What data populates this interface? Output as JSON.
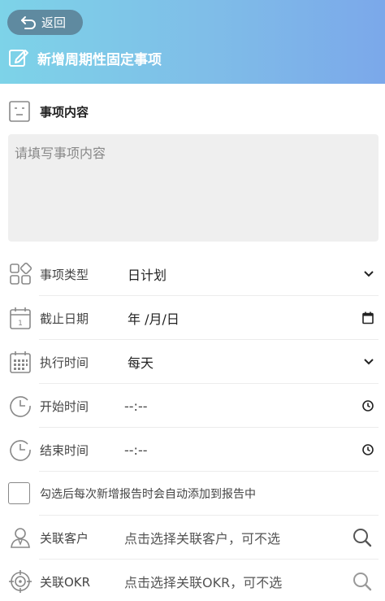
{
  "header": {
    "back_label": "返回",
    "title": "新增周期性固定事项"
  },
  "content_section": {
    "title": "事项内容",
    "placeholder": "请填写事项内容"
  },
  "fields": {
    "type": {
      "label": "事项类型",
      "value": "日计划"
    },
    "deadline": {
      "label": "截止日期",
      "value": "年 /月/日"
    },
    "exec_time": {
      "label": "执行时间",
      "value": "每天"
    },
    "start_time": {
      "label": "开始时间",
      "value": "--:--"
    },
    "end_time": {
      "label": "结束时间",
      "value": "--:--"
    },
    "auto_add": {
      "text": "勾选后每次新增报告时会自动添加到报告中"
    },
    "customer": {
      "label": "关联客户",
      "placeholder": "点击选择关联客户，可不选"
    },
    "okr": {
      "label": "关联OKR",
      "placeholder": "点击选择关联OKR，可不选"
    }
  }
}
